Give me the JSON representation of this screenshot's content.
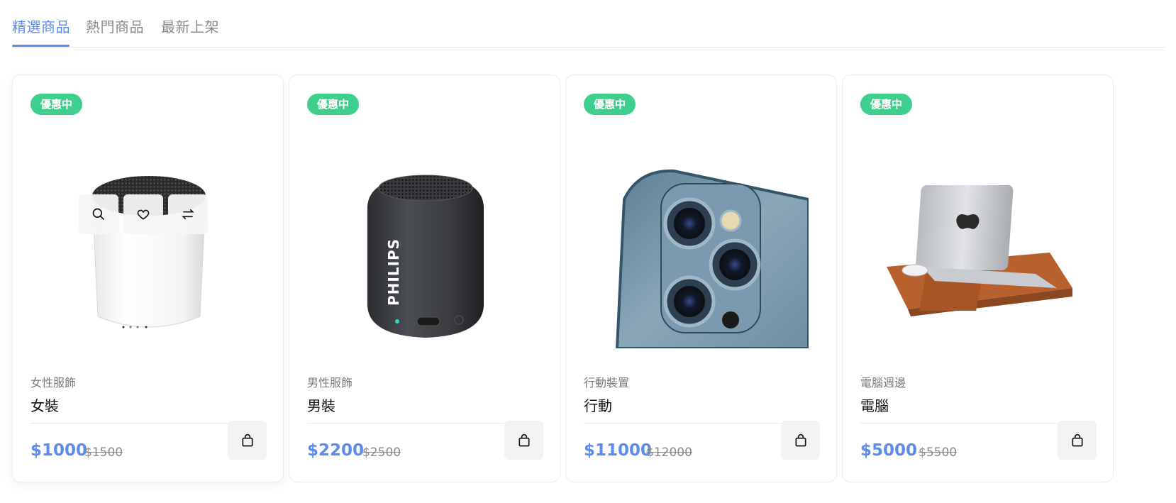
{
  "tabs": [
    {
      "label": "精選商品",
      "active": true
    },
    {
      "label": "熱門商品",
      "active": false
    },
    {
      "label": "最新上架",
      "active": false
    }
  ],
  "colors": {
    "accent": "#5b8def",
    "badge": "#3ecf8e",
    "muted": "#8a8a8a"
  },
  "products": [
    {
      "badge": "優惠中",
      "category": "女性服飾",
      "name": "女裝",
      "price": "$1000",
      "old_price": "$1500",
      "image": "white-speaker"
    },
    {
      "badge": "優惠中",
      "category": "男性服飾",
      "name": "男裝",
      "price": "$2200",
      "old_price": "$2500",
      "image": "philips-speaker",
      "image_text": "PHILIPS"
    },
    {
      "badge": "優惠中",
      "category": "行動裝置",
      "name": "行動",
      "price": "$11000",
      "old_price": "$12000",
      "image": "phone-camera"
    },
    {
      "badge": "優惠中",
      "category": "電腦週邊",
      "name": "電腦",
      "price": "$5000",
      "old_price": "$5500",
      "image": "laptop-stand"
    }
  ],
  "icons": {
    "quick_view": "search-icon",
    "wishlist": "heart-icon",
    "compare": "swap-icon",
    "cart": "shopping-bag-icon"
  }
}
